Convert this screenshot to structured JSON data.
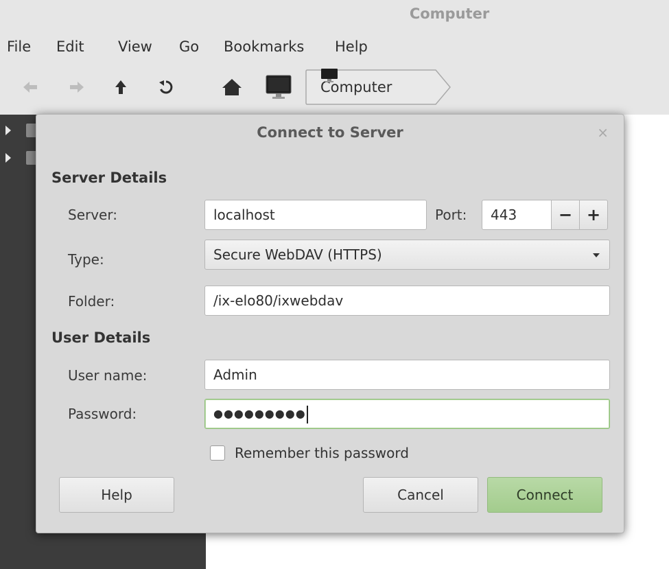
{
  "window": {
    "title": "Computer"
  },
  "menubar": {
    "items": [
      "File",
      "Edit",
      "View",
      "Go",
      "Bookmarks",
      "Help"
    ]
  },
  "toolbar": {
    "icons": [
      "back-arrow-icon",
      "forward-arrow-icon",
      "up-arrow-icon",
      "reload-icon",
      "home-icon",
      "computer-icon"
    ],
    "breadcrumb": "Computer"
  },
  "dialog": {
    "title": "Connect to Server",
    "close_glyph": "×",
    "server_details": {
      "heading": "Server Details",
      "server_label": "Server:",
      "server_value": "localhost",
      "port_label": "Port:",
      "port_value": "443",
      "port_decrement": "−",
      "port_increment": "+",
      "type_label": "Type:",
      "type_value": "Secure WebDAV (HTTPS)",
      "folder_label": "Folder:",
      "folder_value": "/ix-elo80/ixwebdav"
    },
    "user_details": {
      "heading": "User Details",
      "username_label": "User name:",
      "username_value": "Admin",
      "password_label": "Password:",
      "password_masked": "●●●●●●●●●",
      "remember_label": "Remember this password",
      "remember_checked": false
    },
    "buttons": {
      "help": "Help",
      "cancel": "Cancel",
      "connect": "Connect"
    }
  },
  "colors": {
    "accent_green": "#a9d095",
    "sidebar_bg": "#3c3c3c",
    "dialog_bg": "#d9d9d9"
  }
}
